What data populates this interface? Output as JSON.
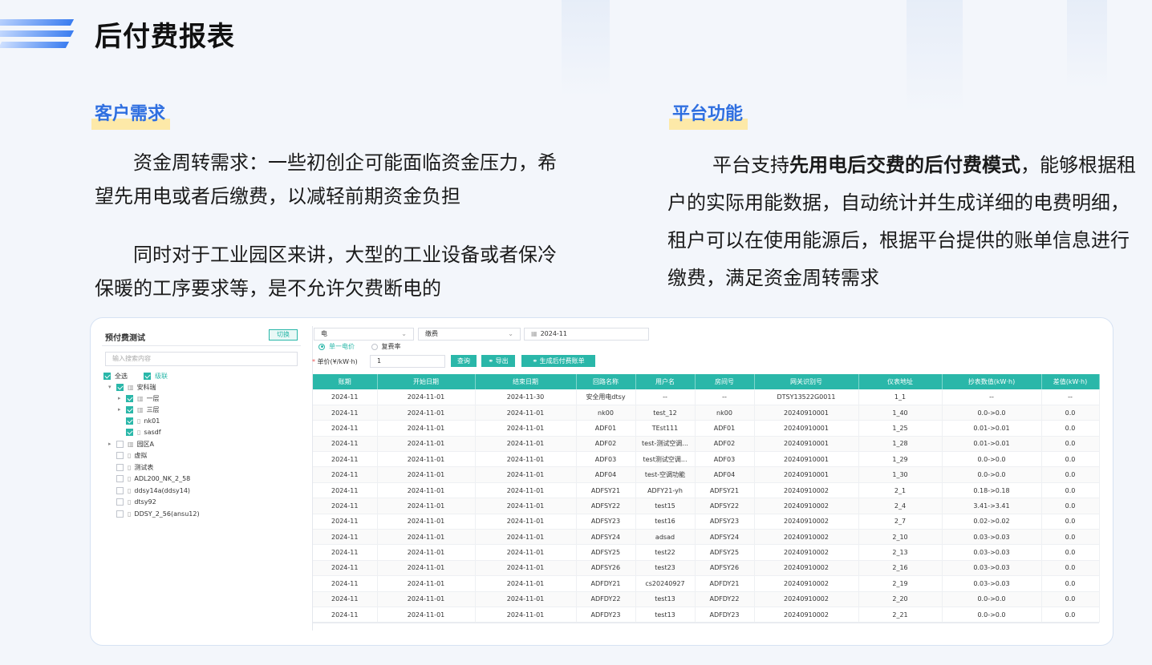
{
  "title": "后付费报表",
  "left_section": {
    "heading": "客户需求",
    "p1": "资金周转需求：一些初创企可能面临资金压力，希望先用电或者后缴费，以减轻前期资金负担",
    "p2": "同时对于工业园区来讲，大型的工业设备或者保冷保暖的工序要求等，是不允许欠费断电的"
  },
  "right_section": {
    "heading": "平台功能",
    "p_before": "平台支持",
    "p_bold": "先用电后交费的后付费模式",
    "p_after": "，能够根据租户的实际用能数据，自动统计并生成详细的电费明细，租户可以在使用能源后，根据平台提供的账单信息进行缴费，满足资金周转需求"
  },
  "app": {
    "tree": {
      "title": "预付费测试",
      "switch_label": "切换",
      "search_placeholder": "输入搜索内容",
      "select_all": "全选",
      "cascade": "级联",
      "nodes": {
        "root": "安科瑞",
        "floor1": "一层",
        "floor3": "三层",
        "nk01": "nk01",
        "sasdf": "sasdf",
        "parkA": "园区A",
        "virtual": "虚拟",
        "testtable": "测试表",
        "adl200": "ADL200_NK_2_58",
        "ddsy14a": "ddsy14a(ddsy14)",
        "dtsy92": "dtsy92",
        "ddsy256": "DDSY_2_56(ansu12)"
      }
    },
    "filters": {
      "energy_type": "电",
      "fee_type": "缴费",
      "month": "2024-11",
      "radio_single": "单一电价",
      "radio_multi": "复费率",
      "unit_price_label": "单价(¥/kW·h)",
      "unit_price_value": "1",
      "query_btn": "查询",
      "export_btn": "导出",
      "generate_btn": "生成后付费账单"
    },
    "table": {
      "headers": [
        "账期",
        "开始日期",
        "结束日期",
        "回路名称",
        "用户名",
        "房间号",
        "网关识别号",
        "仪表地址",
        "抄表数值(kW·h)",
        "差值(kW·h)"
      ],
      "rows": [
        [
          "2024-11",
          "2024-11-01",
          "2024-11-30",
          "安全用电dtsy",
          "--",
          "--",
          "DTSY13522G0011",
          "1_1",
          "--",
          "--"
        ],
        [
          "2024-11",
          "2024-11-01",
          "2024-11-01",
          "nk00",
          "test_12",
          "nk00",
          "20240910001",
          "1_40",
          "0.0->0.0",
          "0.0"
        ],
        [
          "2024-11",
          "2024-11-01",
          "2024-11-01",
          "ADF01",
          "TEst111",
          "ADF01",
          "20240910001",
          "1_25",
          "0.01->0.01",
          "0.0"
        ],
        [
          "2024-11",
          "2024-11-01",
          "2024-11-01",
          "ADF02",
          "test-测试空调...",
          "ADF02",
          "20240910001",
          "1_28",
          "0.01->0.01",
          "0.0"
        ],
        [
          "2024-11",
          "2024-11-01",
          "2024-11-01",
          "ADF03",
          "test测试空调...",
          "ADF03",
          "20240910001",
          "1_29",
          "0.0->0.0",
          "0.0"
        ],
        [
          "2024-11",
          "2024-11-01",
          "2024-11-01",
          "ADF04",
          "test-空调功能",
          "ADF04",
          "20240910001",
          "1_30",
          "0.0->0.0",
          "0.0"
        ],
        [
          "2024-11",
          "2024-11-01",
          "2024-11-01",
          "ADFSY21",
          "ADFY21-yh",
          "ADFSY21",
          "20240910002",
          "2_1",
          "0.18->0.18",
          "0.0"
        ],
        [
          "2024-11",
          "2024-11-01",
          "2024-11-01",
          "ADFSY22",
          "test15",
          "ADFSY22",
          "20240910002",
          "2_4",
          "3.41->3.41",
          "0.0"
        ],
        [
          "2024-11",
          "2024-11-01",
          "2024-11-01",
          "ADFSY23",
          "test16",
          "ADFSY23",
          "20240910002",
          "2_7",
          "0.02->0.02",
          "0.0"
        ],
        [
          "2024-11",
          "2024-11-01",
          "2024-11-01",
          "ADFSY24",
          "adsad",
          "ADFSY24",
          "20240910002",
          "2_10",
          "0.03->0.03",
          "0.0"
        ],
        [
          "2024-11",
          "2024-11-01",
          "2024-11-01",
          "ADFSY25",
          "test22",
          "ADFSY25",
          "20240910002",
          "2_13",
          "0.03->0.03",
          "0.0"
        ],
        [
          "2024-11",
          "2024-11-01",
          "2024-11-01",
          "ADFSY26",
          "test23",
          "ADFSY26",
          "20240910002",
          "2_16",
          "0.03->0.03",
          "0.0"
        ],
        [
          "2024-11",
          "2024-11-01",
          "2024-11-01",
          "ADFDY21",
          "cs20240927",
          "ADFDY21",
          "20240910002",
          "2_19",
          "0.03->0.03",
          "0.0"
        ],
        [
          "2024-11",
          "2024-11-01",
          "2024-11-01",
          "ADFDY22",
          "test13",
          "ADFDY22",
          "20240910002",
          "2_20",
          "0.0->0.0",
          "0.0"
        ],
        [
          "2024-11",
          "2024-11-01",
          "2024-11-01",
          "ADFDY23",
          "test13",
          "ADFDY23",
          "20240910002",
          "2_21",
          "0.0->0.0",
          "0.0"
        ]
      ]
    }
  },
  "colors": {
    "accent": "#2ab7a9",
    "heading_blue": "#2f6fe0",
    "highlight": "#fde9a8"
  }
}
